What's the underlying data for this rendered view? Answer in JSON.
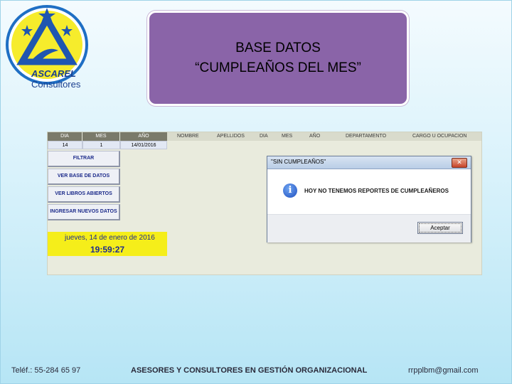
{
  "slide": {
    "logo": {
      "name": "ASCAREL",
      "suffix": " Consultores"
    },
    "title_line1": "BASE DATOS",
    "title_line2": "“CUMPLEAÑOS DEL MES”"
  },
  "sheet": {
    "headers_filled": [
      "DIA",
      "MES",
      "AÑO"
    ],
    "headers_plain": [
      "NOMBRE",
      "APELLIDOS",
      "DIA",
      "MES",
      "AÑO",
      "DEPARTAMENTO",
      "CARGO U OCUPACION"
    ],
    "filter_values": [
      "14",
      "1",
      "14/01/2016"
    ],
    "buttons": {
      "filter": "FILTRAR",
      "view_db": "VER BASE DE DATOS",
      "view_books": "VER LIBROS ABIERTOS",
      "add_data": "INGRESAR NUEVOS DATOS"
    },
    "clock": {
      "date": "jueves, 14 de enero de 2016",
      "time": "19:59:27"
    }
  },
  "dialog": {
    "title": "\"SIN CUMPLEAÑOS\"",
    "close_label": "✕",
    "message": "HOY NO TENEMOS REPORTES DE CUMPLEAÑEROS",
    "ok_label": "Aceptar",
    "icon": "info-icon"
  },
  "footer": {
    "phone": "Teléf.: 55-284 65 97",
    "company": "ASESORES Y CONSULTORES EN GESTIÓN ORGANIZACIONAL",
    "email": "rrpplbm@gmail.com"
  },
  "colors": {
    "title_box": "#8a64a8",
    "clock_bg": "#f5ee1a",
    "button_text": "#1b2a8a"
  }
}
